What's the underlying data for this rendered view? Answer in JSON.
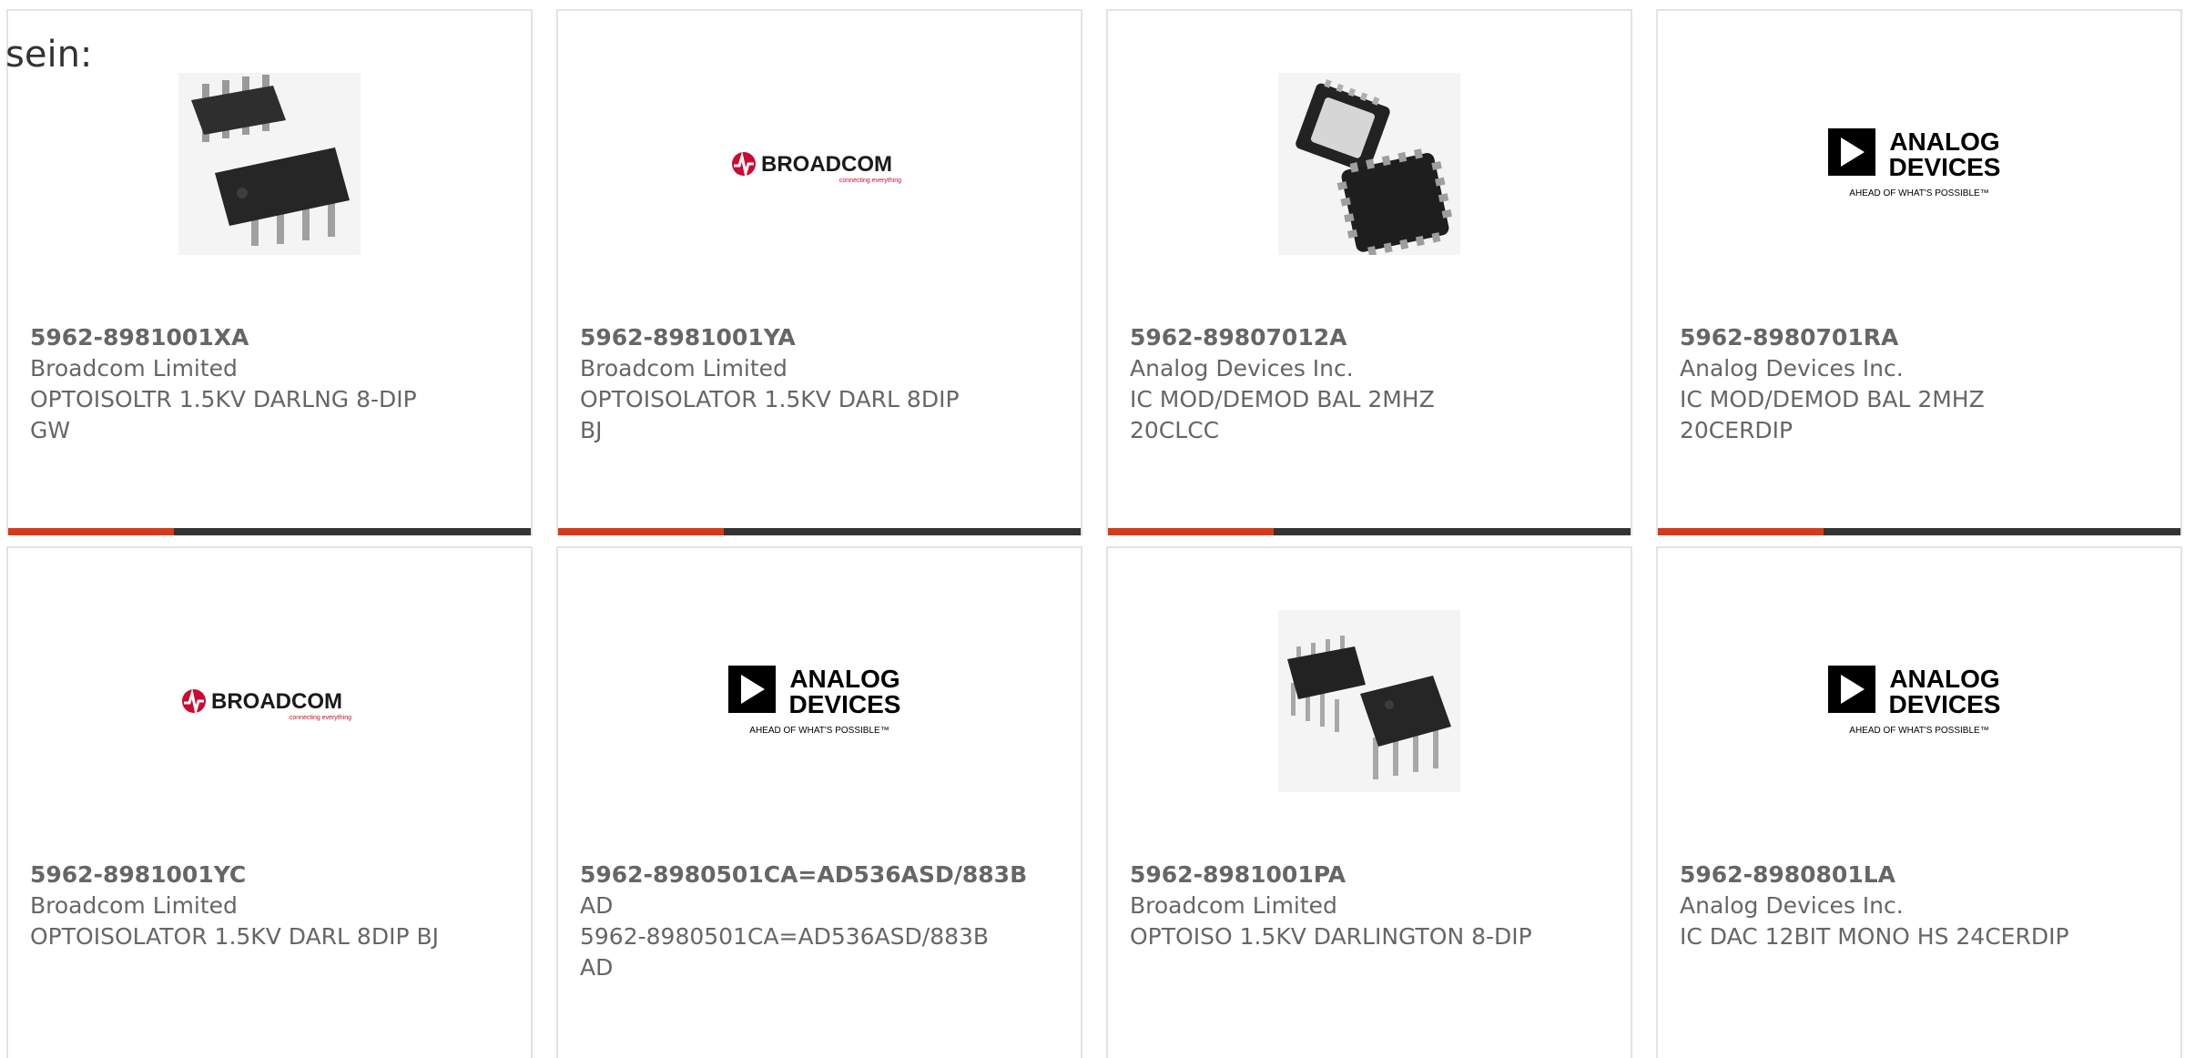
{
  "intro_text": "sein:",
  "products": [
    {
      "part_number": "5962-8981001XA",
      "manufacturer": "Broadcom Limited",
      "description": "OPTOISOLTR 1.5KV DARLNG 8-DIP GW",
      "image": "soic-8-chip"
    },
    {
      "part_number": "5962-8981001YA",
      "manufacturer": "Broadcom Limited",
      "description": "OPTOISOLATOR 1.5KV DARL 8DIP BJ",
      "image": "broadcom-logo"
    },
    {
      "part_number": "5962-89807012A",
      "manufacturer": "Analog Devices Inc.",
      "description": "IC MOD/DEMOD BAL 2MHZ 20CLCC",
      "image": "clcc-chip"
    },
    {
      "part_number": "5962-8980701RA",
      "manufacturer": "Analog Devices Inc.",
      "description": "IC MOD/DEMOD BAL 2MHZ 20CERDIP",
      "image": "analog-devices-logo"
    },
    {
      "part_number": "5962-8981001YC",
      "manufacturer": "Broadcom Limited",
      "description": "OPTOISOLATOR 1.5KV DARL 8DIP BJ",
      "image": "broadcom-logo"
    },
    {
      "part_number": "5962-8980501CA=AD536ASD/883B",
      "manufacturer": "AD",
      "description": "5962-8980501CA=AD536ASD/883B AD",
      "image": "analog-devices-logo"
    },
    {
      "part_number": "5962-8981001PA",
      "manufacturer": "Broadcom Limited",
      "description": "OPTOISO 1.5KV DARLINGTON 8-DIP",
      "image": "dip-8-chip"
    },
    {
      "part_number": "5962-8980801LA",
      "manufacturer": "Analog Devices Inc.",
      "description": "IC DAC 12BIT MONO HS 24CERDIP",
      "image": "analog-devices-logo"
    }
  ],
  "logos": {
    "broadcom": {
      "name": "BROADCOM",
      "tagline": "connecting everything",
      "color": "#cc092f"
    },
    "analog_devices": {
      "line1": "ANALOG",
      "line2": "DEVICES",
      "tagline": "AHEAD OF WHAT'S POSSIBLE™",
      "color": "#000000"
    }
  },
  "colors": {
    "accent": "#d63a1a",
    "bar": "#333333",
    "border": "#e3e3e3",
    "text": "#666666"
  }
}
